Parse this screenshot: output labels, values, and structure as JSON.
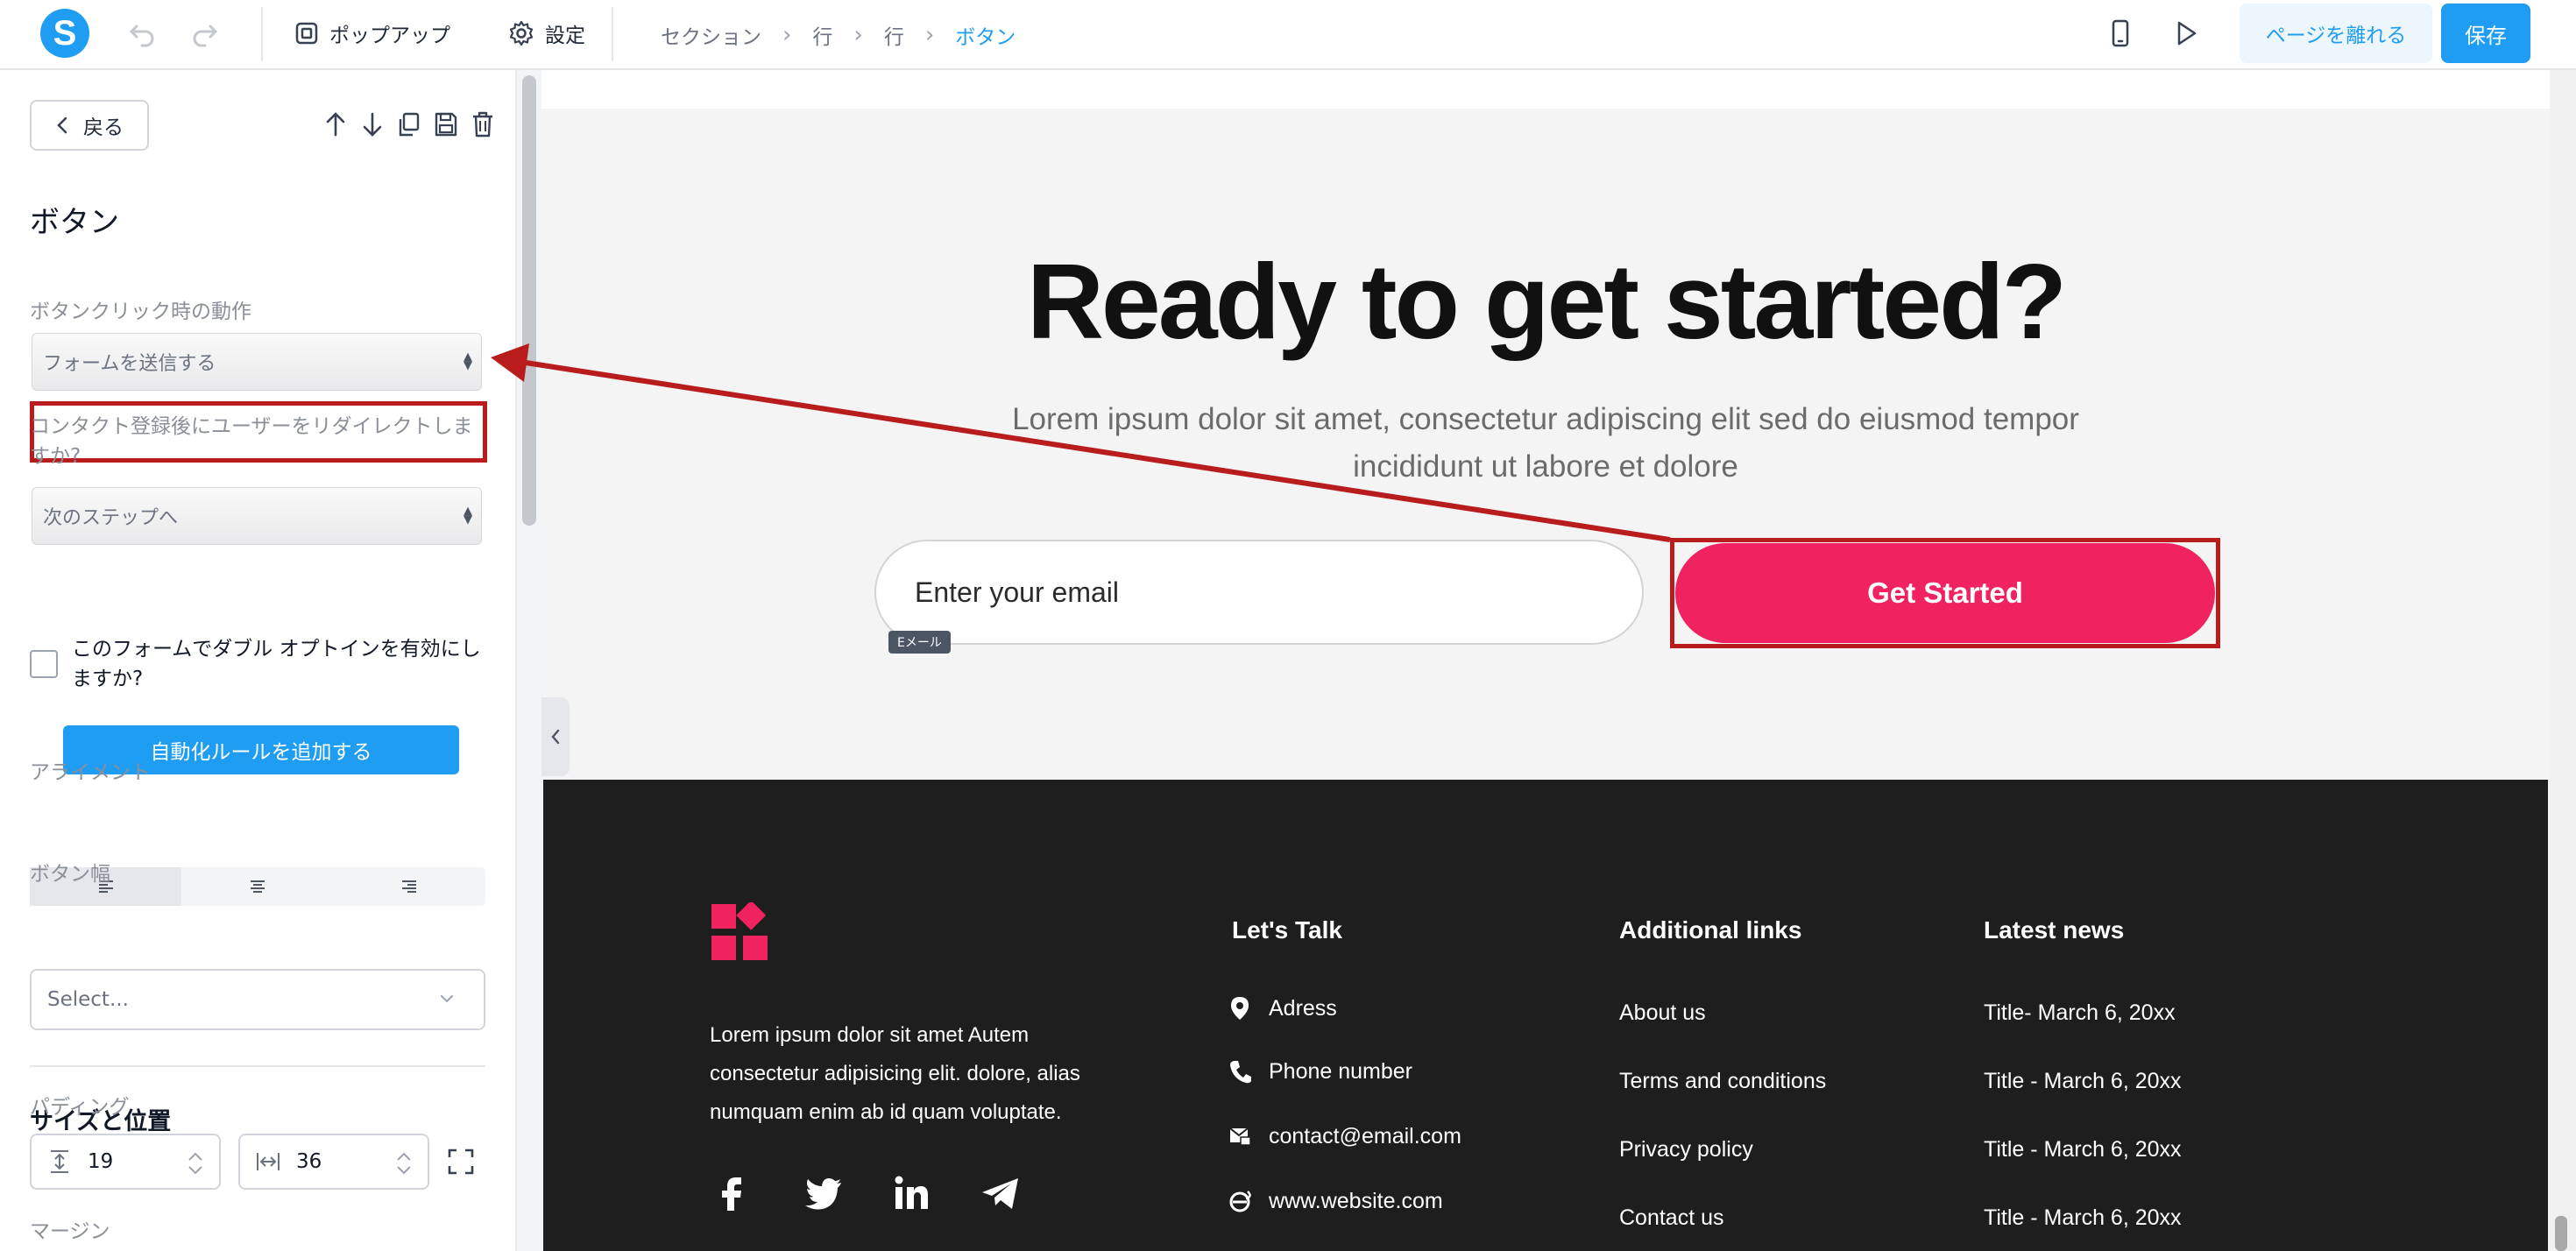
{
  "topbar": {
    "logo_letter": "S",
    "popup_label": "ポップアップ",
    "settings_label": "設定",
    "breadcrumb": [
      "セクション",
      "行",
      "行",
      "ボタン"
    ],
    "leave_label": "ページを離れる",
    "save_label": "保存"
  },
  "panel": {
    "back_label": "戻る",
    "title": "ボタン",
    "click_action_label": "ボタンクリック時の動作",
    "click_action_value": "フォームを送信する",
    "redirect_question": "コンタクト登録後にユーザーをリダイレクトしますか?",
    "redirect_value": "次のステップへ",
    "double_optin_label": "このフォームでダブル オプトインを有効にしますか?",
    "add_rule_label": "自動化ルールを追加する",
    "alignment_label": "アライメント",
    "button_width_label": "ボタン幅",
    "button_width_placeholder": "Select...",
    "size_position_title": "サイズと位置",
    "padding_label": "パディング",
    "padding_vertical": "19",
    "padding_horizontal": "36",
    "margin_label": "マージン"
  },
  "hero": {
    "title": "Ready to get started?",
    "subtitle": "Lorem ipsum dolor sit amet, consectetur adipiscing elit sed do eiusmod tempor incididunt ut labore et dolore",
    "email_placeholder": "Enter your email",
    "email_tag": "Eメール",
    "cta_label": "Get Started"
  },
  "footer": {
    "about": "Lorem ipsum dolor sit amet Autem consectetur adipisicing elit.  dolore, alias numquam enim ab  id quam voluptate.",
    "col1_title": "Let's Talk",
    "contacts": [
      "Adress",
      "Phone number",
      "contact@email.com",
      "www.website.com"
    ],
    "col2_title": "Additional links",
    "links": [
      "About us",
      "Terms and conditions",
      "Privacy policy",
      "Contact us"
    ],
    "col3_title": "Latest news",
    "news": [
      "Title- March 6, 20xx",
      "Title - March 6, 20xx",
      "Title - March 6, 20xx",
      "Title - March 6, 20xx"
    ]
  },
  "colors": {
    "accent_blue": "#1e9df3",
    "cta_pink": "#f12260",
    "annotation_red": "#b91c1c",
    "footer_bg": "#1e1e1f"
  }
}
